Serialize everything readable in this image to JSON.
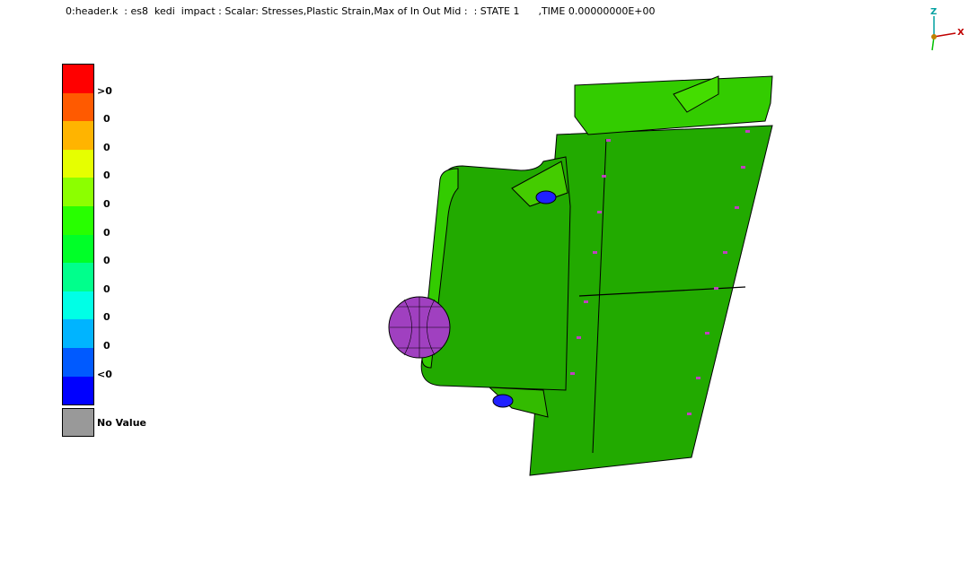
{
  "header": {
    "text": "0:header.k  : es8  kedi  impact : Scalar: Stresses,Plastic Strain,Max of In Out Mid :  : STATE 1      ,TIME 0.00000000E+00"
  },
  "legend": {
    "colors": [
      "#ff0000",
      "#ff5a00",
      "#ffb400",
      "#e6ff00",
      "#8cff00",
      "#28ff00",
      "#00ff28",
      "#00ff8c",
      "#00ffe6",
      "#00b4ff",
      "#005aff",
      "#0000ff"
    ],
    "labels": [
      ">0",
      "0",
      "0",
      "0",
      "0",
      "0",
      "0",
      "0",
      "0",
      "0",
      "<0"
    ],
    "no_value_label": "No Value",
    "no_value_color": "#999999"
  },
  "triad": {
    "z_label": "Z",
    "x_label": "X",
    "z_color": "#00a0a0",
    "x_color": "#c00000",
    "y_color": "#00c000"
  },
  "model": {
    "body_color": "#22bb00",
    "edge_color": "#000000",
    "sphere_color": "#a040c0",
    "hole_color": "#2020ff"
  }
}
